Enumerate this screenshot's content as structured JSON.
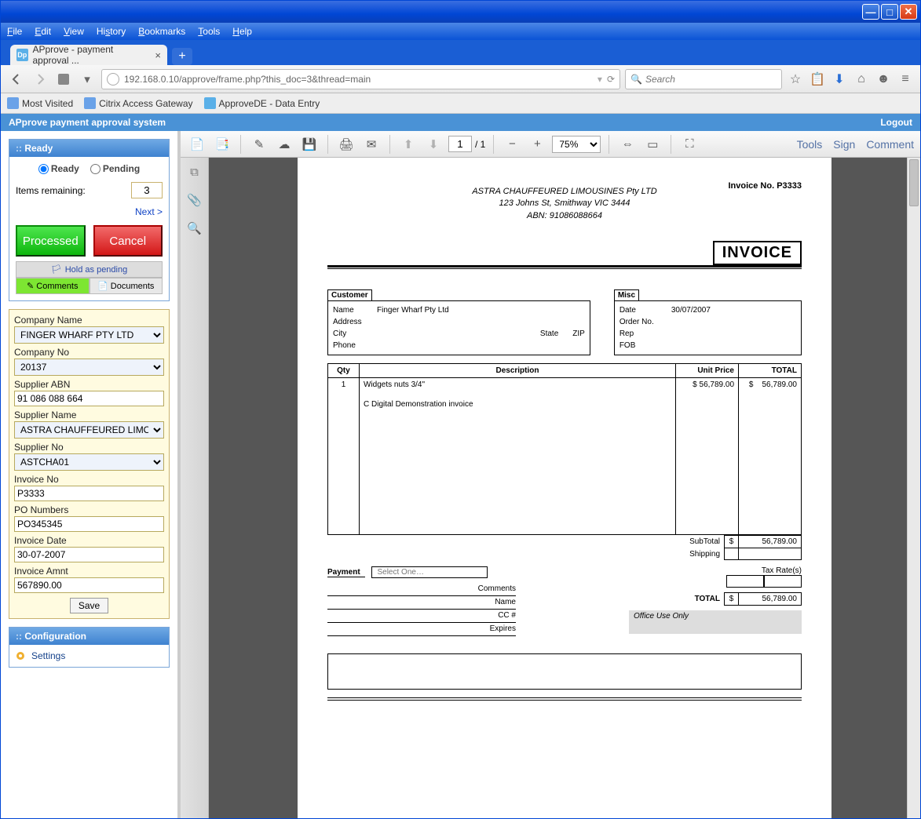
{
  "browser": {
    "menu": [
      "File",
      "Edit",
      "View",
      "History",
      "Bookmarks",
      "Tools",
      "Help"
    ],
    "tab_title": "APprove - payment approval ...",
    "url": "192.168.0.10/approve/frame.php?this_doc=3&thread=main",
    "search_placeholder": "Search",
    "bookmarks": [
      "Most Visited",
      "Citrix Access Gateway",
      "ApproveDE - Data Entry"
    ]
  },
  "app": {
    "title": "APprove payment approval system",
    "logout": "Logout"
  },
  "ready": {
    "header": "Ready",
    "radio_ready": "Ready",
    "radio_pending": "Pending",
    "items_label": "Items remaining:",
    "items_value": "3",
    "next": "Next >",
    "processed": "Processed",
    "cancel": "Cancel",
    "hold": "Hold as pending",
    "comments_tab": "Comments",
    "documents_tab": "Documents"
  },
  "form": {
    "company_name_label": "Company Name",
    "company_name": "FINGER WHARF PTY LTD",
    "company_no_label": "Company No",
    "company_no": "20137",
    "supplier_abn_label": "Supplier ABN",
    "supplier_abn": "91 086 088 664",
    "supplier_name_label": "Supplier Name",
    "supplier_name": "ASTRA CHAUFFEURED LIMOU",
    "supplier_no_label": "Supplier No",
    "supplier_no": "ASTCHA01",
    "invoice_no_label": "Invoice No",
    "invoice_no": "P3333",
    "po_numbers_label": "PO Numbers",
    "po_numbers": "PO345345",
    "invoice_date_label": "Invoice Date",
    "invoice_date": "30-07-2007",
    "invoice_amnt_label": "Invoice Amnt",
    "invoice_amnt": "567890.00",
    "save": "Save"
  },
  "config": {
    "header": "Configuration",
    "settings": "Settings"
  },
  "pdf": {
    "page_current": "1",
    "page_total": "/  1",
    "zoom": "75%",
    "tools": "Tools",
    "sign": "Sign",
    "comment": "Comment"
  },
  "invoice": {
    "company": "ASTRA CHAUFFEURED LIMOUSINES Pty LTD",
    "address": "123 Johns St, Smithway VIC 3444",
    "abn": "ABN: 91086088664",
    "invno_label": "Invoice No. P3333",
    "title": "INVOICE",
    "customer_header": "Customer",
    "misc_header": "Misc",
    "cust": {
      "name_k": "Name",
      "name_v": "Finger Wharf Pty Ltd",
      "address_k": "Address",
      "city_k": "City",
      "state_k": "State",
      "zip_k": "ZIP",
      "phone_k": "Phone"
    },
    "misc": {
      "date_k": "Date",
      "date_v": "30/07/2007",
      "order_k": "Order No.",
      "rep_k": "Rep",
      "fob_k": "FOB"
    },
    "cols": {
      "qty": "Qty",
      "desc": "Description",
      "unit": "Unit Price",
      "total": "TOTAL"
    },
    "line": {
      "qty": "1",
      "desc1": "Widgets nuts 3/4\"",
      "desc2": "C Digital Demonstration invoice",
      "unit": "$ 56,789.00",
      "total_cur": "$",
      "total": "56,789.00"
    },
    "subtotal_label": "SubTotal",
    "subtotal_cur": "$",
    "subtotal": "56,789.00",
    "shipping_label": "Shipping",
    "taxrate_label": "Tax Rate(s)",
    "total_label": "TOTAL",
    "total_cur": "$",
    "total": "56,789.00",
    "payment_label": "Payment",
    "select_one": "Select One…",
    "pay_comments": "Comments",
    "pay_name": "Name",
    "pay_cc": "CC #",
    "pay_exp": "Expires",
    "office": "Office Use Only"
  }
}
